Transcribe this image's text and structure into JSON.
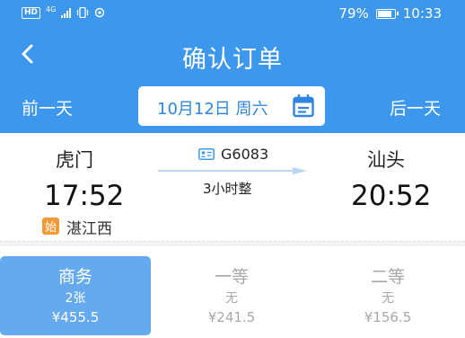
{
  "status_bar": {
    "hd": "HD",
    "network": "4G",
    "battery": "79%",
    "time": "10:33"
  },
  "header": {
    "title": "确认订单",
    "prev_day": "前一天",
    "next_day": "后一天",
    "date": "10月12日 周六",
    "back_icon": "chevron-left-icon",
    "calendar_icon": "calendar-icon",
    "bg_color": "#3d97ec"
  },
  "train": {
    "from_station": "虎门",
    "to_station": "汕头",
    "departure_time": "17:52",
    "arrival_time": "20:52",
    "train_number": "G6083",
    "duration": "3小时整",
    "start_badge": "始",
    "origin_station": "湛江西"
  },
  "seats": [
    {
      "name": "商务",
      "availability": "2张",
      "price": "¥455.5",
      "selected": true
    },
    {
      "name": "一等",
      "availability": "无",
      "price": "¥241.5",
      "selected": false
    },
    {
      "name": "二等",
      "availability": "无",
      "price": "¥156.5",
      "selected": false
    }
  ],
  "colors": {
    "accent": "#3d97ec",
    "selected_seat": "#65a9ef",
    "badge_orange": "#f39a37",
    "unavailable_text": "#a8a8a8"
  }
}
